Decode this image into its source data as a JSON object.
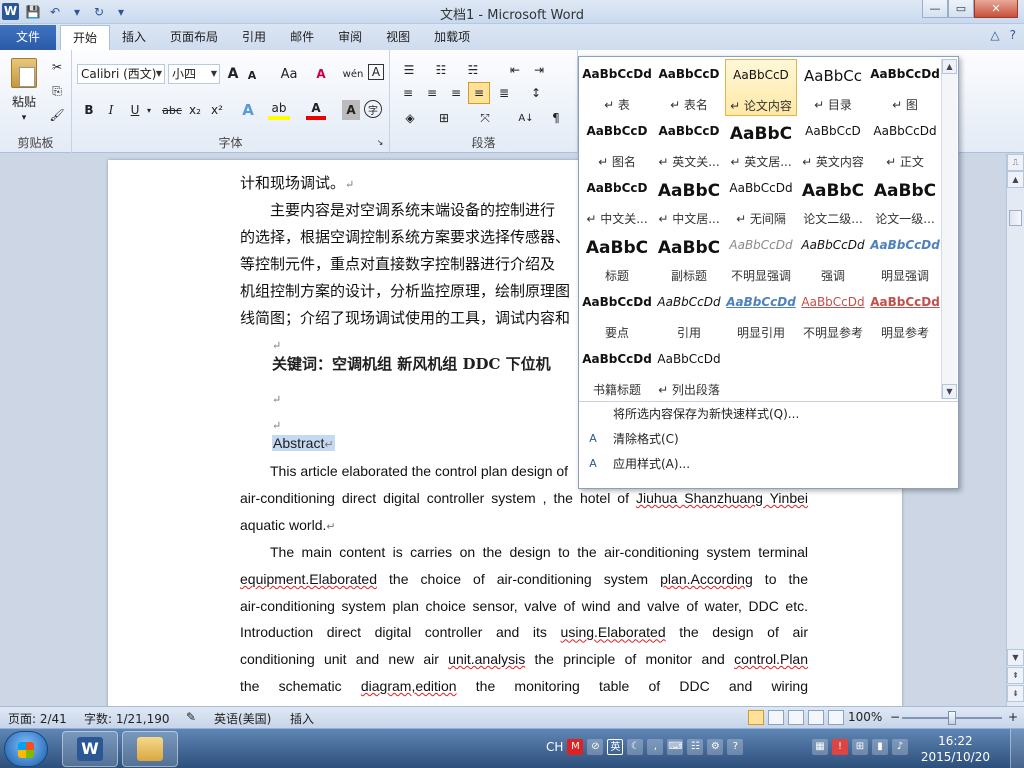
{
  "window": {
    "title": "文档1 - Microsoft Word",
    "app_icon": "W",
    "controls": {
      "minimize": "—",
      "maximize": "▭",
      "close": "✕"
    }
  },
  "qat": {
    "save": "💾",
    "undo": "↶",
    "redo": "↻",
    "customize": "▾"
  },
  "tabs": {
    "file": "文件",
    "items": [
      "开始",
      "插入",
      "页面布局",
      "引用",
      "邮件",
      "审阅",
      "视图",
      "加载项"
    ],
    "active": "开始",
    "minimize_ribbon": "△",
    "help": "?"
  },
  "ribbon": {
    "clipboard": {
      "label": "剪贴板",
      "paste": "粘贴",
      "cut": "✂",
      "copy": "⎘",
      "format_painter": "🖌"
    },
    "font": {
      "label": "字体",
      "font_name": "Calibri (西文)",
      "font_size": "小四",
      "grow": "A",
      "shrink": "A",
      "change_case": "Aa",
      "clear": "A",
      "phonetic": "wén",
      "border": "A",
      "bold": "B",
      "italic": "I",
      "underline": "U",
      "strike": "abc",
      "sub": "x₂",
      "sup": "x²",
      "effects": "A",
      "highlight": "ab",
      "color": "A",
      "shading": "A",
      "enclose": "字"
    },
    "paragraph": {
      "label": "段落",
      "sort": "A↓"
    }
  },
  "document": {
    "line1": "计和现场调试。",
    "para1": "主要内容是对空调系统末端设备的控制进行设计，阐述了空调系统方案的选择，根据空调控制系统方案要求选择传感器、风阀、水阀、DDC等控制元件，重点对直接数字控制器进行介绍及空调机组控制方案的设计，分析监控原理，绘制原理图、监控点表及接线简图；介绍了现场调试使用的工具，调试内容和步骤。",
    "para1_lines": [
      "主要内容是对空调系统末端设备的控制进行",
      "的选择，根据空调控制系统方案要求选择传感器、",
      "等控制元件，重点对直接数字控制器进行介绍及",
      "机组控制方案的设计，分析监控原理，绘制原理图",
      "线简图；介绍了现场调试使用的工具，调试内容和"
    ],
    "keywords_label": "关键词：",
    "keywords": "空调机组   新风机组    DDC   下位机",
    "abstract_heading": "Abstract",
    "en_para1": [
      "This article elaborated the control plan design of",
      "air-conditioning direct digital controller system , the hotel of",
      "Jiuhua Shanzhuang Yinbei",
      "aquatic world."
    ],
    "en_para2": [
      "The main content is carries on the design to the air-conditioning system terminal",
      "equipment.Elaborated",
      " the choice of air-conditioning system ",
      "plan.According",
      " to the",
      "air-conditioning system plan choice sensor, valve of wind and valve of water, DDC etc.",
      "Introduction direct digital controller and its ",
      "using.Elaborated",
      " the design of air",
      "conditioning unit and new air ",
      "unit.analysis",
      " the principle of monitor and ",
      "control.Plan",
      "the schematic ",
      "diagram,edition",
      " the monitoring table of DDC and wiring"
    ],
    "para_mark": "↵"
  },
  "styles_gallery": {
    "styles": [
      {
        "sample": "AaBbCcDd",
        "name": "↵ 表",
        "bold": true
      },
      {
        "sample": "AaBbCcD",
        "name": "↵ 表名",
        "bold": true
      },
      {
        "sample": "AaBbCcD",
        "name": "↵ 论文内容",
        "selected": true
      },
      {
        "sample": "AaBbCc",
        "name": "↵ 目录"
      },
      {
        "sample": "AaBbCcDd",
        "name": "↵ 图",
        "bold": true
      },
      {
        "sample": "AaBbCcD",
        "name": "↵ 图名",
        "bold": true
      },
      {
        "sample": "AaBbCcD",
        "name": "↵ 英文关...",
        "bold": true
      },
      {
        "sample": "AaBbC",
        "name": "↵ 英文居...",
        "bold": true
      },
      {
        "sample": "AaBbCcD",
        "name": "↵ 英文内容"
      },
      {
        "sample": "AaBbCcDd",
        "name": "↵ 正文"
      },
      {
        "sample": "AaBbCcD",
        "name": "↵ 中文关...",
        "bold": true
      },
      {
        "sample": "AaBbC",
        "name": "↵ 中文居...",
        "bold": true
      },
      {
        "sample": "AaBbCcDd",
        "name": "↵ 无间隔"
      },
      {
        "sample": "AaBbC",
        "name": "论文二级...",
        "bold": true
      },
      {
        "sample": "AaBbC",
        "name": "论文一级...",
        "bold": true
      },
      {
        "sample": "AaBbC",
        "name": "标题",
        "bold": true
      },
      {
        "sample": "AaBbC",
        "name": "副标题",
        "bold": true
      },
      {
        "sample": "AaBbCcDd",
        "name": "不明显强调",
        "italic": true,
        "color": "#8a8a8a"
      },
      {
        "sample": "AaBbCcDd",
        "name": "强调",
        "italic": true
      },
      {
        "sample": "AaBbCcDd",
        "name": "明显强调",
        "italic": true,
        "color": "#4f81bd",
        "bold": true
      },
      {
        "sample": "AaBbCcDd",
        "name": "要点",
        "bold": true
      },
      {
        "sample": "AaBbCcDd",
        "name": "引用",
        "italic": true
      },
      {
        "sample": "AaBbCcDd",
        "name": "明显引用",
        "italic": true,
        "color": "#4f81bd",
        "bold": true,
        "underline": true
      },
      {
        "sample": "AaBbCcDd",
        "name": "不明显参考",
        "color": "#c0504d",
        "underline": true
      },
      {
        "sample": "AaBbCcDd",
        "name": "明显参考",
        "color": "#c0504d",
        "underline": true,
        "bold": true
      },
      {
        "sample": "AaBbCcDd",
        "name": "书籍标题",
        "bold": true
      },
      {
        "sample": "AaBbCcDd",
        "name": "↵ 列出段落"
      }
    ],
    "menu": [
      {
        "label": "将所选内容保存为新快速样式(Q)...",
        "icon": ""
      },
      {
        "label": "清除格式(C)",
        "icon": "A"
      },
      {
        "label": "应用样式(A)...",
        "icon": "A"
      }
    ]
  },
  "statusbar": {
    "page": "页面: 2/41",
    "words": "字数: 1/21,190",
    "language": "英语(美国)",
    "insert": "插入",
    "zoom": "100%",
    "zoom_level": 1.0,
    "zoom_minus": "−",
    "zoom_plus": "+"
  },
  "taskbar": {
    "ime": "CH",
    "tray_english": "英",
    "time": "16:22",
    "date": "2015/10/20",
    "word_icon": "W"
  },
  "colors": {
    "accent": "#2b5797",
    "selection": "#c5d9f1",
    "spell_error": "#dd2222"
  }
}
